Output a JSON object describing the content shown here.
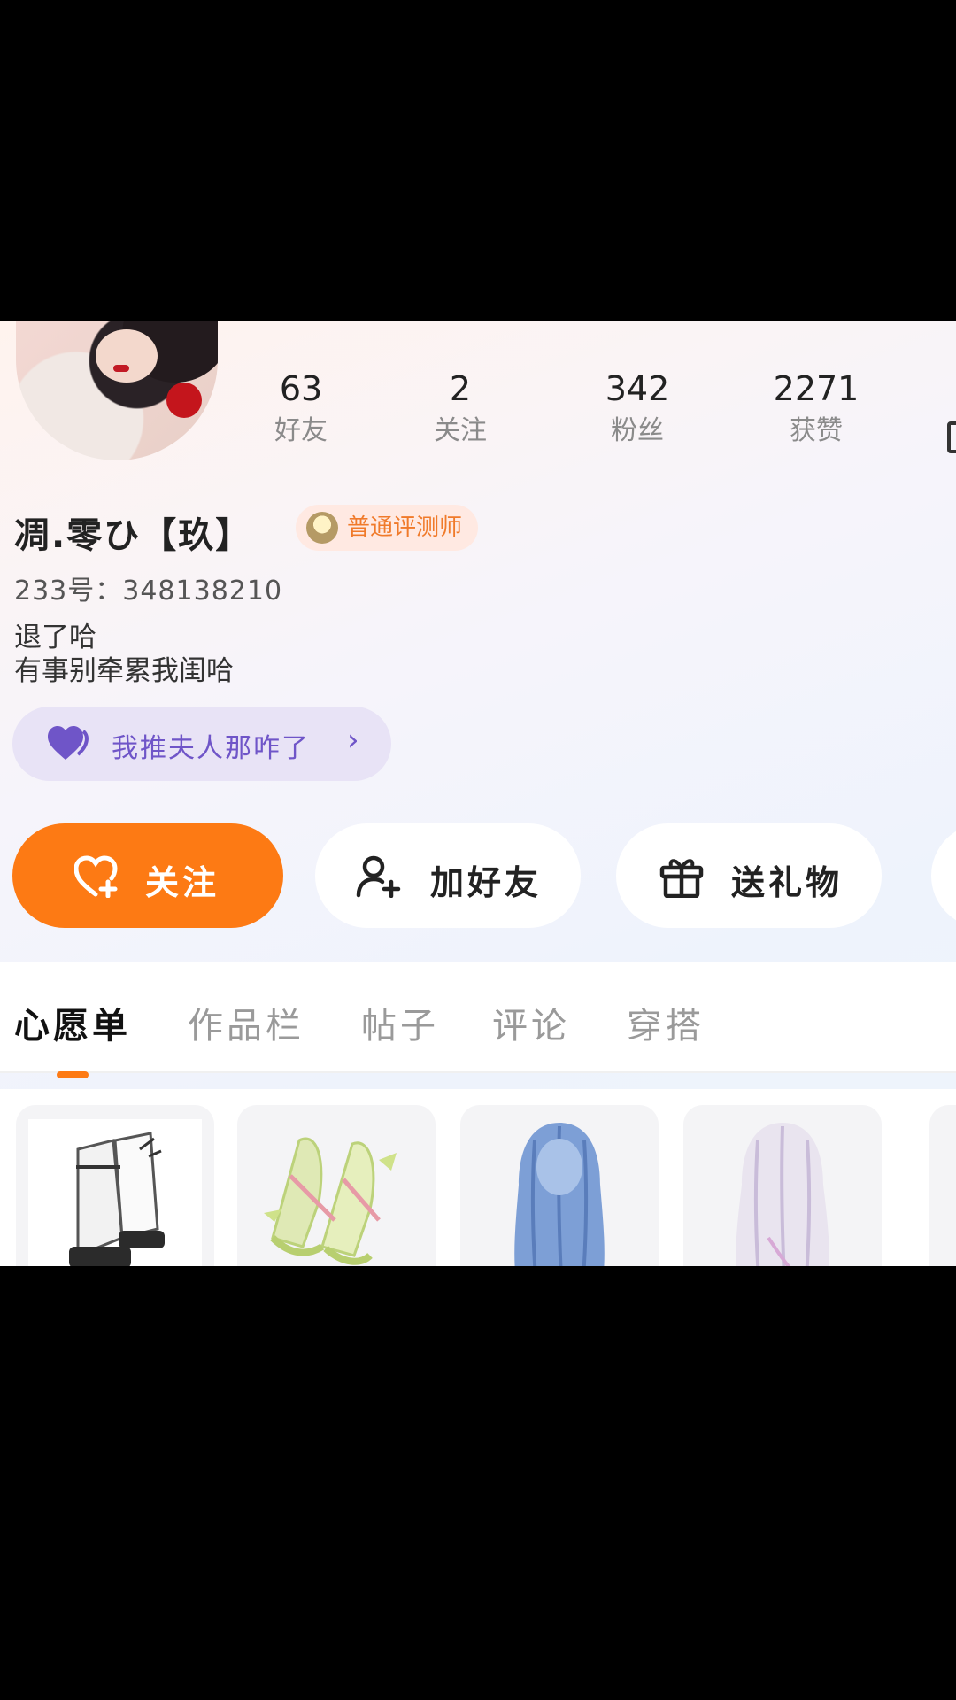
{
  "profile": {
    "nickname": "凋.零ひ【玖】",
    "badge": "普通评测师",
    "uid": "233号：348138210",
    "bio": [
      "退了哈",
      "有事别牵累我闺哈"
    ]
  },
  "stats": [
    {
      "value": "63",
      "label": "好友"
    },
    {
      "value": "2",
      "label": "关注"
    },
    {
      "value": "342",
      "label": "粉丝"
    },
    {
      "value": "2271",
      "label": "获赞"
    }
  ],
  "tag_pill": {
    "label": "我推夫人那咋了",
    "arrow": "›"
  },
  "actions": {
    "follow": "关注",
    "add_friend": "加好友",
    "gift": "送礼物"
  },
  "tabs": [
    "心愿单",
    "作品栏",
    "帖子",
    "评论",
    "穿搭"
  ],
  "colors": {
    "accent": "#fd7a14",
    "pill_text": "#6f55c8"
  },
  "wishlist": [
    {
      "name": "boots-item",
      "icon": "boots-icon"
    },
    {
      "name": "shoes-item",
      "icon": "shoes-icon"
    },
    {
      "name": "blue-hair-item",
      "icon": "hair-icon"
    },
    {
      "name": "white-hair-item",
      "icon": "hair-icon"
    }
  ]
}
